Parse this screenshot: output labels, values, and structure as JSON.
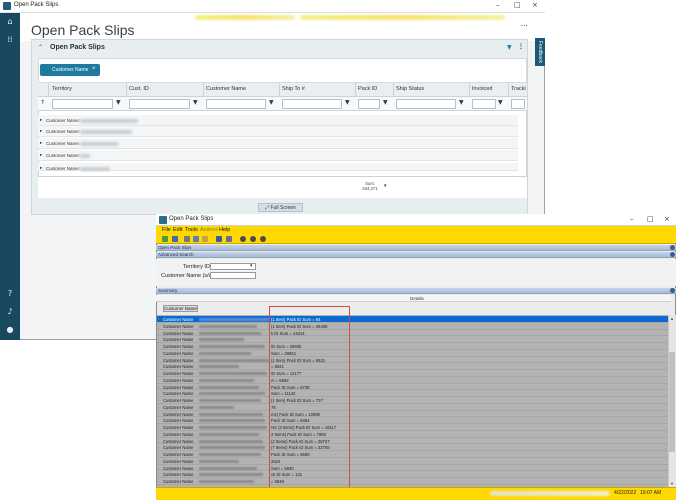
{
  "window1": {
    "title": "Open Pack Slips",
    "page_title": "Open Pack Slips",
    "panel_label": "Open Pack Slips",
    "feedback_label": "Feedback",
    "group_chip": "Customer Name",
    "columns": [
      "Territory",
      "Cust. ID",
      "Customer Name",
      "Ship To #",
      "Pack ID",
      "Ship Status",
      "Invoiced",
      "Tracki"
    ],
    "group_rows": [
      "Customer Name:",
      "Customer Name:",
      "Customer Name:",
      "Customer Name:",
      "Customer Name:"
    ],
    "sum_label": "Sum:",
    "sum_value": "634,271",
    "fullscreen_label": "Full Screen",
    "icons": {
      "app": "app-icon",
      "filter": "filter-icon",
      "more": "kebab-icon",
      "chevron": "chevron-up-icon"
    }
  },
  "window2": {
    "title": "Open Pack Slips",
    "menu": [
      "File",
      "Edit",
      "Tools",
      "Actions",
      "Help"
    ],
    "section_open": "Open Pack Slips",
    "section_advanced": "Advanced Search",
    "territory_label": "Territory ID",
    "customer_label": "Customer Name (s/w)",
    "section_summary": "Summary",
    "details_label": "Details",
    "group_chip": "Customer Name",
    "rows": [
      {
        "prefix": "Customer Name",
        "suffix": "(1 Item) Pack ID Sum = 64"
      },
      {
        "prefix": "Customer Name",
        "suffix": "(1 Item) Pack ID Sum = 36408"
      },
      {
        "prefix": "Customer Name",
        "suffix": "k ID Sum = 44314"
      },
      {
        "prefix": "Customer Name",
        "suffix": ""
      },
      {
        "prefix": "Customer Name",
        "suffix": "ID Sum = 29930"
      },
      {
        "prefix": "Customer Name",
        "suffix": "Sum = 28651"
      },
      {
        "prefix": "Customer Name",
        "suffix": "(1 Item) Pack ID Sum = 6621"
      },
      {
        "prefix": "Customer Name",
        "suffix": "= 5641"
      },
      {
        "prefix": "Customer Name",
        "suffix": "ID Sum = 12177"
      },
      {
        "prefix": "Customer Name",
        "suffix": "m = 5593"
      },
      {
        "prefix": "Customer Name",
        "suffix": "Pack ID Sum = 5739"
      },
      {
        "prefix": "Customer Name",
        "suffix": "Sum = 11142"
      },
      {
        "prefix": "Customer Name",
        "suffix": "(1 Item) Pack ID Sum = 737"
      },
      {
        "prefix": "Customer Name",
        "suffix": "76"
      },
      {
        "prefix": "Customer Name",
        "suffix": "ms) Pack ID Sum = 10990"
      },
      {
        "prefix": "Customer Name",
        "suffix": "Pack ID Sum = 6464"
      },
      {
        "prefix": "Customer Name",
        "suffix": "NS (3 Items) Pack ID Sum = 16117"
      },
      {
        "prefix": "Customer Name",
        "suffix": "2 Items) Pack ID Sum = 7969"
      },
      {
        "prefix": "Customer Name",
        "suffix": "(2 Items) Pack ID Sum = 28707"
      },
      {
        "prefix": "Customer Name",
        "suffix": "(7 Items) Pack ID Sum = 32708"
      },
      {
        "prefix": "Customer Name",
        "suffix": "Pack ID Sum = 6688"
      },
      {
        "prefix": "Customer Name",
        "suffix": "2524"
      },
      {
        "prefix": "Customer Name",
        "suffix": "Sum = 5830"
      },
      {
        "prefix": "Customer Name",
        "suffix": "ck ID Sum = 131"
      },
      {
        "prefix": "Customer Name",
        "suffix": "= 5848"
      }
    ],
    "status_date": "4/22/2022",
    "status_time": "10:07 AM"
  },
  "colors": {
    "nav": "#18495f",
    "accent": "#1d7aa0",
    "legacy_yellow": "#ffd800",
    "selection": "#0a6ad1",
    "highlight": "#d44a4a"
  }
}
